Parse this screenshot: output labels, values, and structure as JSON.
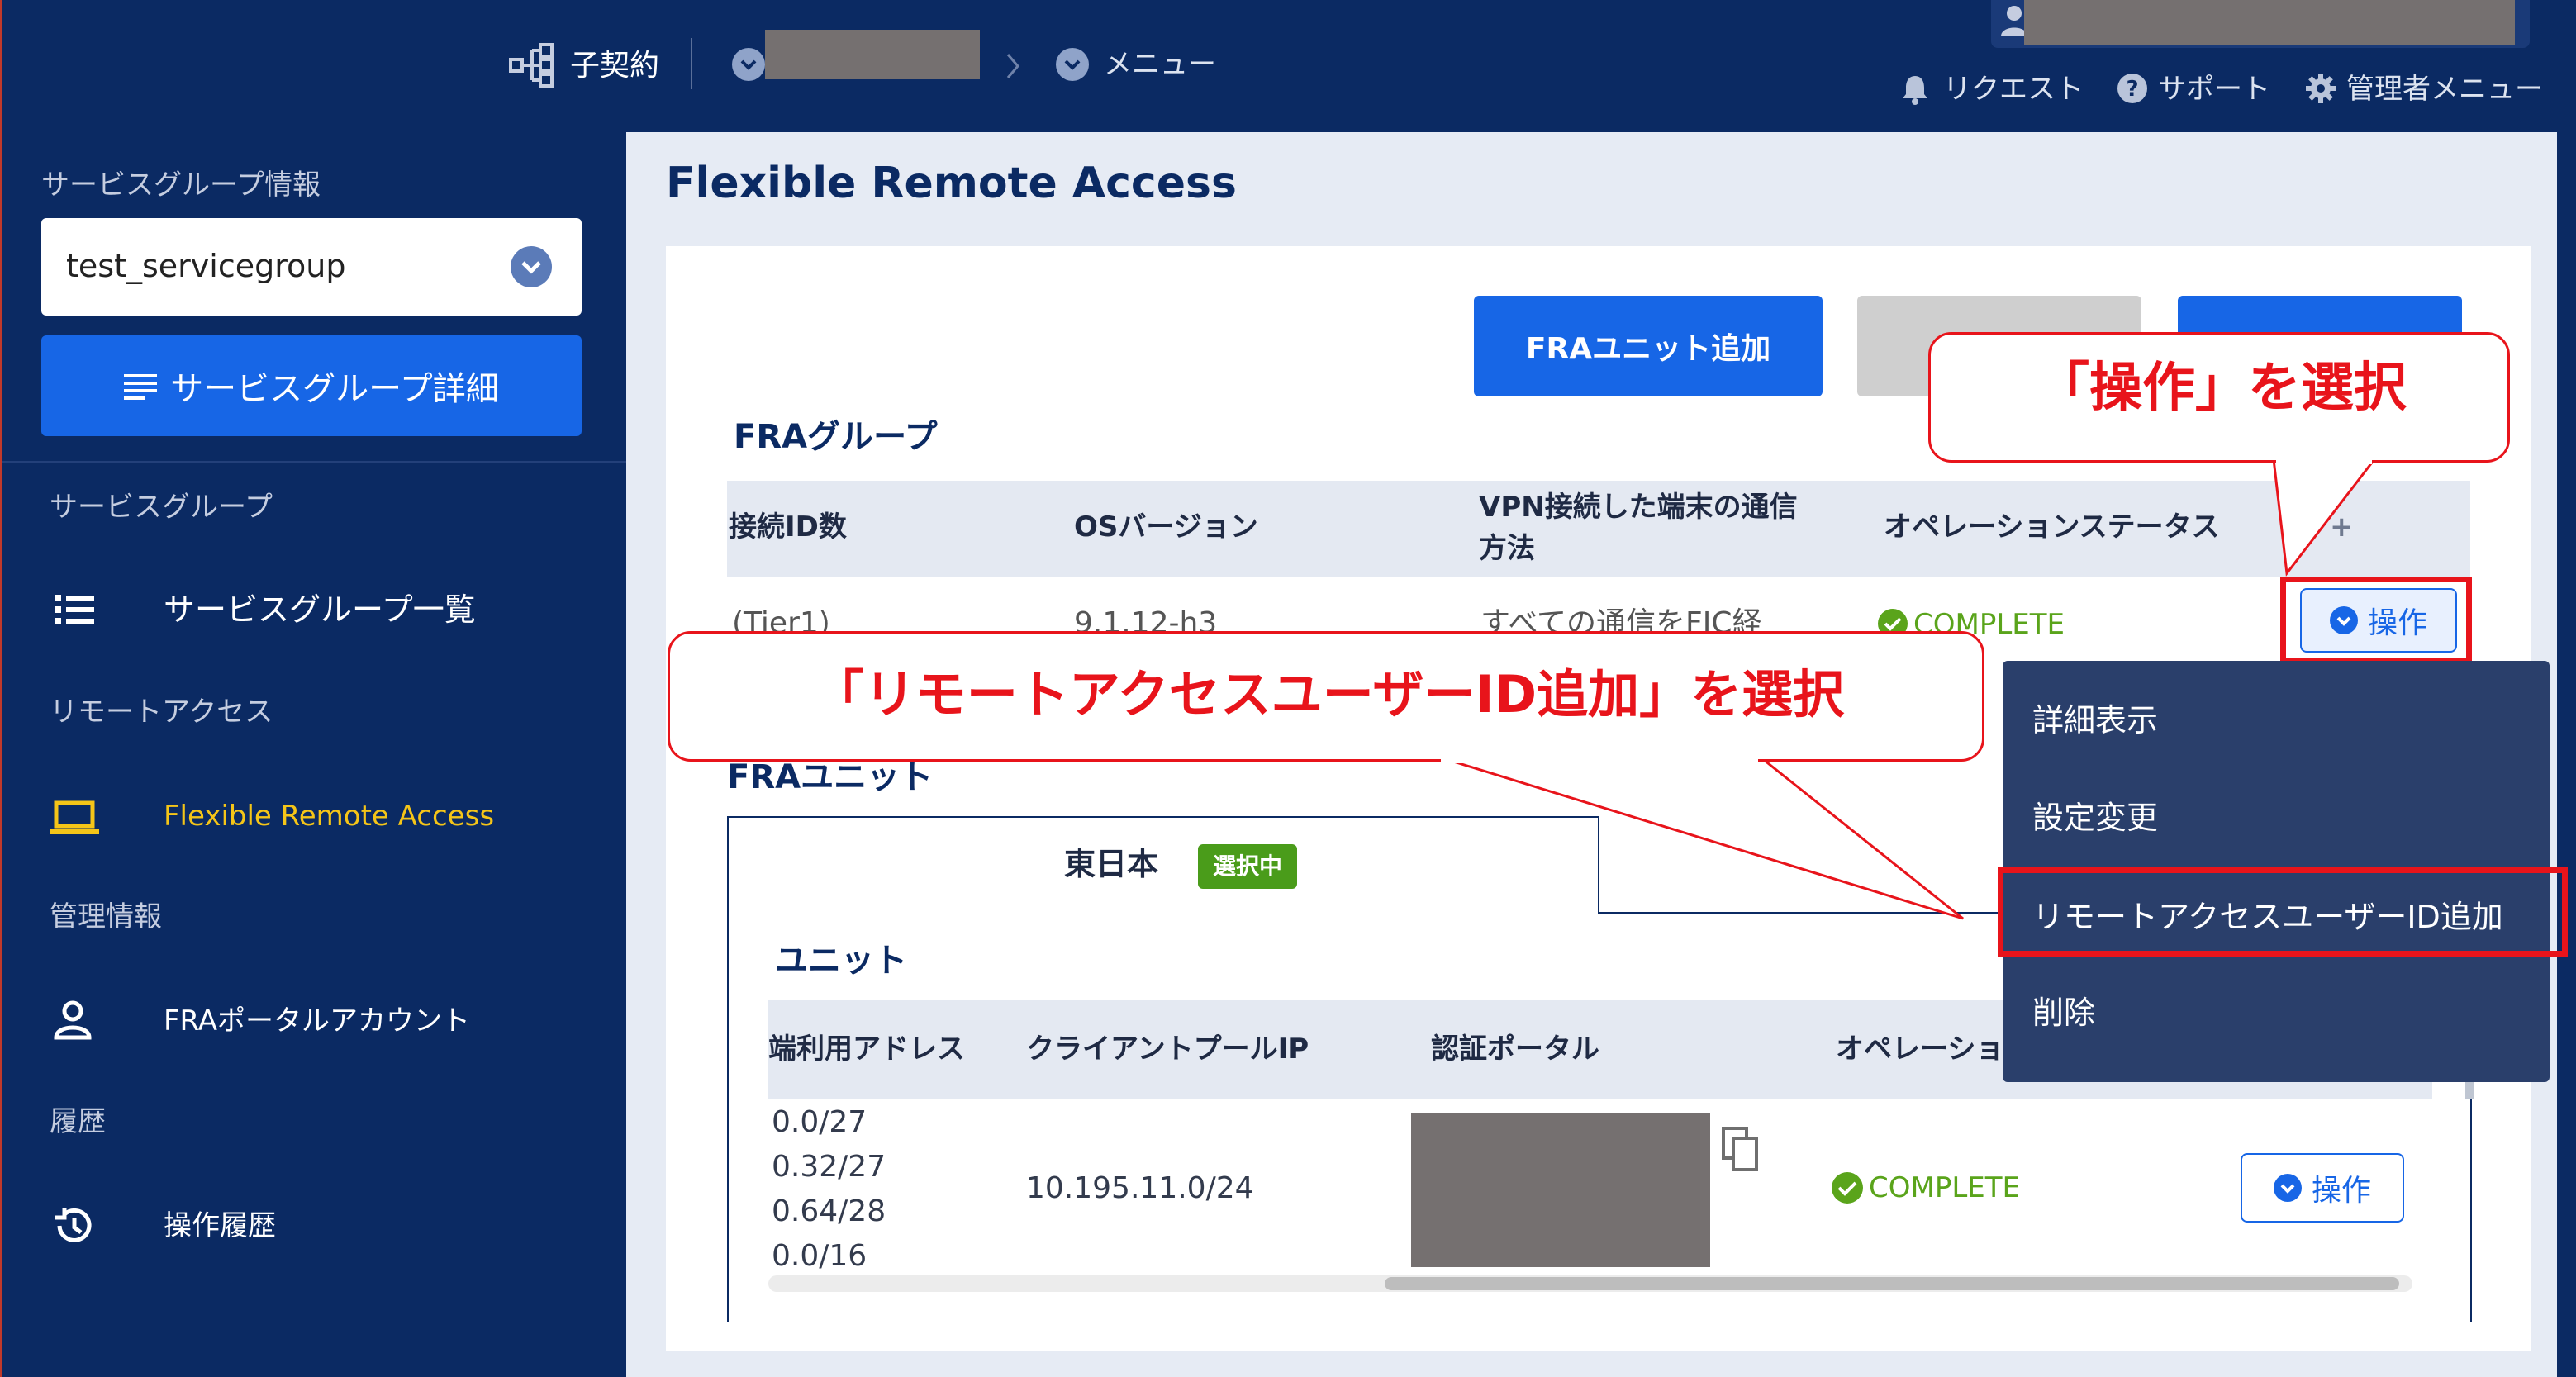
{
  "topbar": {
    "contract_label": "子契約",
    "menu_label": "メニュー",
    "request_label": "リクエスト",
    "support_label": "サポート",
    "admin_label": "管理者メニュー"
  },
  "sidebar": {
    "group_info_label": "サービスグループ情報",
    "group_select_value": "test_servicegroup",
    "group_detail_button": "サービスグループ詳細",
    "sections": {
      "service_group": "サービスグループ",
      "remote_access": "リモートアクセス",
      "management": "管理情報",
      "history": "履歴"
    },
    "items": {
      "group_list": "サービスグループ一覧",
      "fra": "Flexible Remote Access",
      "portal_account": "FRAポータルアカウント",
      "op_history": "操作履歴"
    }
  },
  "main": {
    "page_title": "Flexible Remote Access",
    "add_unit_button": "FRAユニット追加",
    "fra_group": {
      "title": "FRAグループ",
      "columns": [
        "接続ID数",
        "OSバージョン",
        "VPN接続した端末の通信",
        "方法",
        "オペレーションステータス",
        "+"
      ],
      "row": {
        "id_count": "(Tier1)",
        "os_version": "9.1.12-h3",
        "vpn_method": "すべての通信をFIC経",
        "status": "COMPLETE"
      },
      "op_button": "操作"
    },
    "fra_unit": {
      "title": "FRAユニット",
      "tab_east": "東日本",
      "tab_badge": "選択中",
      "unit_title": "ユニット",
      "columns": [
        "端利用アドレス",
        "クライアントプールIP",
        "認証ポータル",
        "オペレーショ"
      ],
      "addresses": [
        "0.0/27",
        "0.32/27",
        "0.64/28",
        "0.0/16"
      ],
      "client_pool_ip": "10.195.11.0/24",
      "status": "COMPLETE",
      "op_button": "操作"
    }
  },
  "dropdown": {
    "items": [
      "詳細表示",
      "設定変更",
      "リモートアクセスユーザーID追加",
      "削除"
    ]
  },
  "callouts": {
    "select_operation": "「操作」を選択",
    "select_add_user": "「リモートアクセスユーザーID追加」を選択"
  },
  "colors": {
    "navy": "#0b2a63",
    "primary_blue": "#1766e6",
    "active_yellow": "#f5c518",
    "success_green": "#5aa41b",
    "annotation_red": "#e8141b"
  }
}
